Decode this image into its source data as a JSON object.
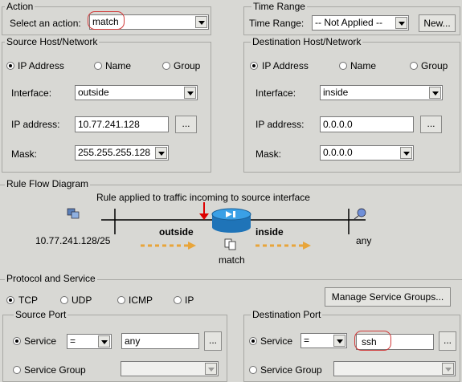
{
  "action": {
    "title": "Action",
    "select_label": "Select an action:",
    "value": "match"
  },
  "time_range": {
    "title": "Time Range",
    "label": "Time Range:",
    "value": "-- Not Applied --",
    "new_button": "New..."
  },
  "source": {
    "title": "Source Host/Network",
    "radios": [
      "IP Address",
      "Name",
      "Group"
    ],
    "selected": "IP Address",
    "interface_label": "Interface:",
    "interface_value": "outside",
    "ip_label": "IP address:",
    "ip_value": "10.77.241.128",
    "browse": "...",
    "mask_label": "Mask:",
    "mask_value": "255.255.255.128"
  },
  "destination": {
    "title": "Destination Host/Network",
    "radios": [
      "IP Address",
      "Name",
      "Group"
    ],
    "selected": "IP Address",
    "interface_label": "Interface:",
    "interface_value": "inside",
    "ip_label": "IP address:",
    "ip_value": "0.0.0.0",
    "browse": "...",
    "mask_label": "Mask:",
    "mask_value": "0.0.0.0"
  },
  "diagram": {
    "title": "Rule Flow Diagram",
    "caption": "Rule applied to traffic incoming to source interface",
    "source_label": "10.77.241.128/25",
    "outside_label": "outside",
    "inside_label": "inside",
    "dest_label": "any",
    "action_label": "match"
  },
  "protocol": {
    "title": "Protocol and Service",
    "options": [
      "TCP",
      "UDP",
      "ICMP",
      "IP"
    ],
    "selected": "TCP",
    "manage_button": "Manage Service Groups..."
  },
  "source_port": {
    "title": "Source Port",
    "service_label": "Service",
    "operator": "=",
    "value": "any",
    "browse": "...",
    "group_label": "Service Group"
  },
  "destination_port": {
    "title": "Destination Port",
    "service_label": "Service",
    "operator": "=",
    "value": "ssh",
    "browse": "...",
    "group_label": "Service Group"
  },
  "colors": {
    "highlight": "#d23a3a",
    "flow_arrow": "#e8a53a",
    "router": "#2a8fd6",
    "background": "#d8d8d4"
  }
}
